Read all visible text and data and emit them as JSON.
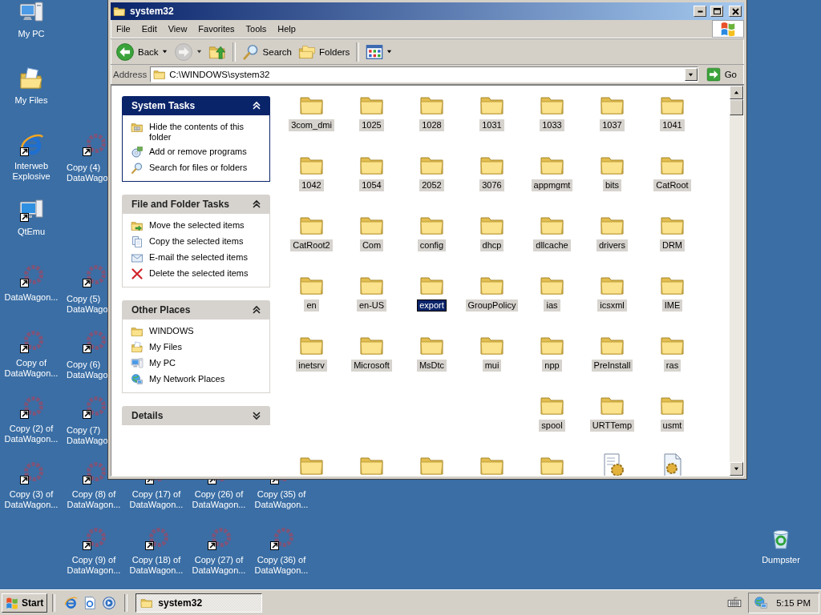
{
  "desktop": {
    "icons": [
      {
        "kind": "computer",
        "label": "My PC"
      },
      {
        "kind": "my-files",
        "label": "My Files"
      },
      {
        "kind": "browser-shortcut",
        "label": "Interweb Explosive"
      },
      {
        "kind": "ring-shortcut",
        "label": "Copy (4) DataWago"
      },
      {
        "kind": "emulator-shortcut",
        "label": "QtEmu"
      },
      {
        "kind": "ring-shortcut",
        "label": "DataWagon..."
      },
      {
        "kind": "ring-shortcut",
        "label": "Copy (5) DataWago"
      },
      {
        "kind": "ring-shortcut",
        "label": "Copy of DataWagon..."
      },
      {
        "kind": "ring-shortcut",
        "label": "Copy (6) DataWago"
      },
      {
        "kind": "ring-shortcut",
        "label": "Copy (2) of DataWagon..."
      },
      {
        "kind": "ring-shortcut",
        "label": "Copy (7) DataWago"
      },
      {
        "kind": "ring-shortcut",
        "label": "Copy (3) of DataWagon..."
      },
      {
        "kind": "ring-shortcut",
        "label": "Copy (8) of DataWagon..."
      },
      {
        "kind": "ring-shortcut",
        "label": "Copy (17) of DataWagon..."
      },
      {
        "kind": "ring-shortcut",
        "label": "Copy (26) of DataWagon..."
      },
      {
        "kind": "ring-shortcut",
        "label": "Copy (35) of DataWagon..."
      },
      {
        "kind": "ring-shortcut",
        "label": "Copy (9) of DataWagon..."
      },
      {
        "kind": "ring-shortcut",
        "label": "Copy (18) of DataWagon..."
      },
      {
        "kind": "ring-shortcut",
        "label": "Copy (27) of DataWagon..."
      },
      {
        "kind": "ring-shortcut",
        "label": "Copy (36) of DataWagon..."
      },
      {
        "kind": "recycle-bin",
        "label": "Dumpster"
      }
    ]
  },
  "window": {
    "title": "system32",
    "menu": [
      "File",
      "Edit",
      "View",
      "Favorites",
      "Tools",
      "Help"
    ],
    "toolbar": [
      {
        "kind": "back",
        "label": "Back",
        "dropdown": true,
        "disabled": false
      },
      {
        "kind": "forward",
        "dropdown": true,
        "disabled": true
      },
      {
        "kind": "up",
        "disabled": false
      },
      {
        "kind": "separator"
      },
      {
        "kind": "search",
        "label": "Search",
        "disabled": false
      },
      {
        "kind": "folders",
        "label": "Folders",
        "disabled": false
      },
      {
        "kind": "separator"
      },
      {
        "kind": "views",
        "dropdown": true,
        "disabled": false
      }
    ],
    "address": {
      "label": "Address",
      "value": "C:\\WINDOWS\\system32",
      "go": "Go"
    },
    "sidebar": [
      {
        "title": "System Tasks",
        "kind": "special",
        "expanded": true,
        "items": [
          {
            "kind": "hide-contents",
            "label": "Hide the contents of this folder"
          },
          {
            "kind": "add-remove",
            "label": "Add or remove programs"
          },
          {
            "kind": "search",
            "label": "Search for files or folders"
          }
        ]
      },
      {
        "title": "File and Folder Tasks",
        "kind": "normal",
        "expanded": true,
        "items": [
          {
            "kind": "move",
            "label": "Move the selected items"
          },
          {
            "kind": "copy",
            "label": "Copy the selected items"
          },
          {
            "kind": "email",
            "label": "E-mail the selected items"
          },
          {
            "kind": "delete",
            "label": "Delete the selected items"
          }
        ]
      },
      {
        "title": "Other Places",
        "kind": "normal",
        "expanded": true,
        "items": [
          {
            "kind": "folder",
            "label": "WINDOWS"
          },
          {
            "kind": "my-files",
            "label": "My Files"
          },
          {
            "kind": "computer",
            "label": "My PC"
          },
          {
            "kind": "network",
            "label": "My Network Places"
          }
        ]
      },
      {
        "title": "Details",
        "kind": "normal",
        "expanded": false
      }
    ],
    "folder_view": {
      "items": [
        {
          "kind": "folder",
          "label": "3com_dmi",
          "selected": true,
          "focused": false
        },
        {
          "kind": "folder",
          "label": "1025",
          "selected": true,
          "focused": false
        },
        {
          "kind": "folder",
          "label": "1028",
          "selected": true,
          "focused": false
        },
        {
          "kind": "folder",
          "label": "1031",
          "selected": true,
          "focused": false
        },
        {
          "kind": "folder",
          "label": "1033",
          "selected": true,
          "focused": false
        },
        {
          "kind": "folder",
          "label": "1037",
          "selected": true,
          "focused": false
        },
        {
          "kind": "folder",
          "label": "1041",
          "selected": true,
          "focused": false
        },
        {
          "kind": "folder",
          "label": "1042",
          "selected": true,
          "focused": false
        },
        {
          "kind": "folder",
          "label": "1054",
          "selected": true,
          "focused": false
        },
        {
          "kind": "folder",
          "label": "2052",
          "selected": true,
          "focused": false
        },
        {
          "kind": "folder",
          "label": "3076",
          "selected": true,
          "focused": false
        },
        {
          "kind": "folder",
          "label": "appmgmt",
          "selected": true,
          "focused": false
        },
        {
          "kind": "folder",
          "label": "bits",
          "selected": true,
          "focused": false
        },
        {
          "kind": "folder",
          "label": "CatRoot",
          "selected": true,
          "focused": false
        },
        {
          "kind": "folder",
          "label": "CatRoot2",
          "selected": true,
          "focused": false
        },
        {
          "kind": "folder",
          "label": "Com",
          "selected": true,
          "focused": false
        },
        {
          "kind": "folder",
          "label": "config",
          "selected": true,
          "focused": false
        },
        {
          "kind": "folder",
          "label": "dhcp",
          "selected": true,
          "focused": false
        },
        {
          "kind": "folder",
          "label": "dllcache",
          "selected": true,
          "focused": false
        },
        {
          "kind": "folder",
          "label": "drivers",
          "selected": true,
          "focused": false
        },
        {
          "kind": "folder",
          "label": "DRM",
          "selected": true,
          "focused": false
        },
        {
          "kind": "folder",
          "label": "en",
          "selected": true,
          "focused": false
        },
        {
          "kind": "folder",
          "label": "en-US",
          "selected": true,
          "focused": false
        },
        {
          "kind": "folder",
          "label": "export",
          "selected": true,
          "focused": true
        },
        {
          "kind": "folder",
          "label": "GroupPolicy",
          "selected": true,
          "focused": false
        },
        {
          "kind": "folder",
          "label": "ias",
          "selected": true,
          "focused": false
        },
        {
          "kind": "folder",
          "label": "icsxml",
          "selected": true,
          "focused": false
        },
        {
          "kind": "folder",
          "label": "IME",
          "selected": true,
          "focused": false
        },
        {
          "kind": "folder",
          "label": "inetsrv",
          "selected": true,
          "focused": false
        },
        {
          "kind": "folder",
          "label": "Microsoft",
          "selected": true,
          "focused": false
        },
        {
          "kind": "folder",
          "label": "MsDtc",
          "selected": true,
          "focused": false
        },
        {
          "kind": "folder",
          "label": "mui",
          "selected": true,
          "focused": false
        },
        {
          "kind": "folder",
          "label": "npp",
          "selected": true,
          "focused": false
        },
        {
          "kind": "folder",
          "label": "PreInstall",
          "selected": true,
          "focused": false
        },
        {
          "kind": "folder",
          "label": "ras",
          "selected": true,
          "focused": false
        },
        {
          "kind": "blank"
        },
        {
          "kind": "blank"
        },
        {
          "kind": "blank"
        },
        {
          "kind": "blank"
        },
        {
          "kind": "folder",
          "label": "spool",
          "selected": true,
          "focused": false
        },
        {
          "kind": "folder",
          "label": "URTTemp",
          "selected": true,
          "focused": false
        },
        {
          "kind": "folder",
          "label": "usmt",
          "selected": true,
          "focused": false
        }
      ],
      "partly_visible_items": [
        {
          "kind": "folder"
        },
        {
          "kind": "folder"
        },
        {
          "kind": "folder"
        },
        {
          "kind": "folder"
        },
        {
          "kind": "folder"
        },
        {
          "kind": "settings-file"
        },
        {
          "kind": "script-file"
        }
      ]
    }
  },
  "taskbar": {
    "start": "Start",
    "tasks": [
      {
        "label": "system32",
        "selected": true
      }
    ],
    "clock": "5:15 PM"
  }
}
